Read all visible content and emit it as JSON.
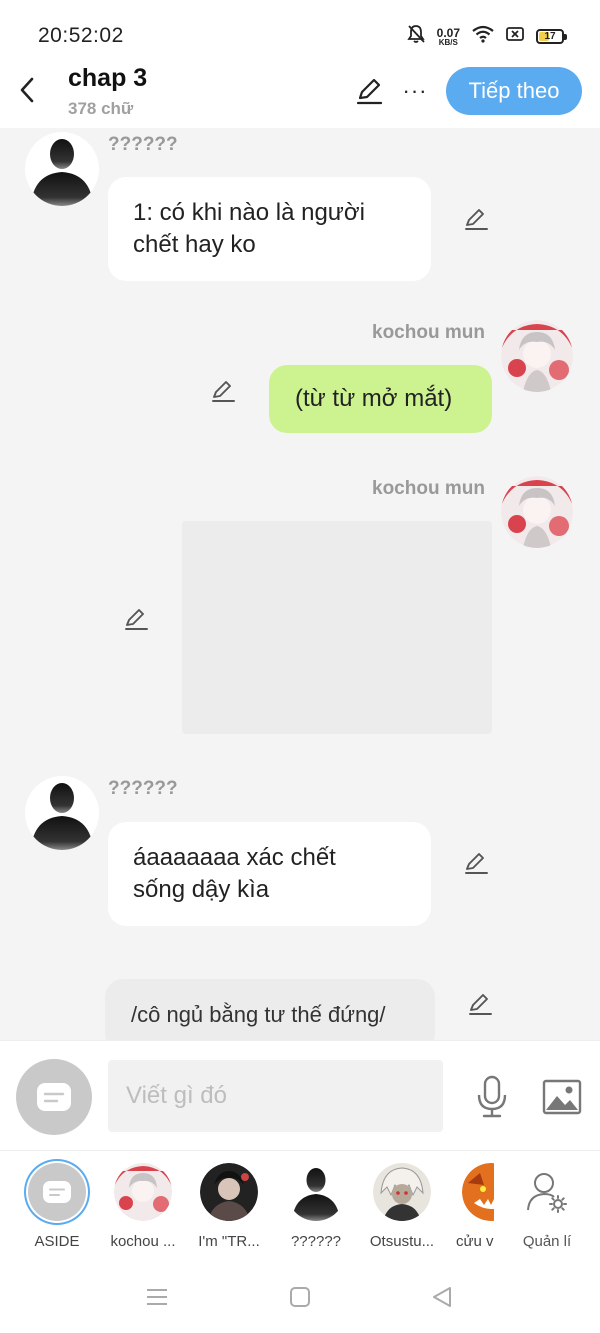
{
  "status_bar": {
    "time": "20:52:02",
    "net_speed_value": "0.07",
    "net_speed_unit": "KB/S",
    "battery": "17",
    "icons": [
      "bell-off-icon",
      "wifi-icon",
      "sim-off-icon",
      "battery-icon"
    ]
  },
  "header": {
    "title": "chap 3",
    "word_count": "378 chữ",
    "next_label": "Tiếp theo",
    "more_label": "···"
  },
  "messages": [
    {
      "side": "left",
      "sender": "??????",
      "text_line1": "1: có khi nào là người",
      "text_line2": "chết hay ko"
    },
    {
      "side": "right",
      "sender": "kochou mun",
      "text": "(từ từ mở mắt)"
    },
    {
      "side": "right",
      "sender": "kochou mun",
      "type": "image"
    },
    {
      "side": "left",
      "sender": "??????",
      "text_line1": "áaaaaaaa xác chết",
      "text_line2": "sống dậy kìa"
    },
    {
      "side": "aside",
      "text": "/cô ngủ bằng tư thế đứng/"
    }
  ],
  "composer": {
    "placeholder": "Viết gì đó"
  },
  "characters": [
    {
      "name": "ASIDE",
      "selected": true
    },
    {
      "name": "kochou ..."
    },
    {
      "name": "I'm \"TR..."
    },
    {
      "name": "??????"
    },
    {
      "name": "Otsustu..."
    },
    {
      "name": "cửu v"
    },
    {
      "name": "Quản lí"
    }
  ],
  "colors": {
    "accent": "#5aabf0",
    "right_bubble": "#cdf391",
    "chat_background": "#f4f4f4"
  }
}
